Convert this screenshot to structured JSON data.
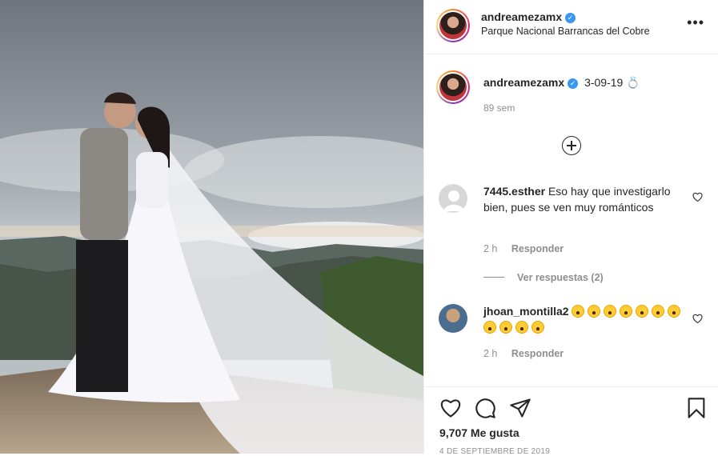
{
  "post": {
    "username": "andreamezamx",
    "location": "Parque Nacional Barrancas del Cobre",
    "caption_text": "3-09-19",
    "caption_emoji": "💍",
    "caption_time": "89 sem",
    "more_label": "•••",
    "likes": "9,707 Me gusta",
    "date": "4 DE SEPTIEMBRE DE 2019"
  },
  "comments": [
    {
      "username": "7445.esther",
      "text": "Eso hay que investigarlo bien, pues se ven muy románticos",
      "time": "2 h",
      "reply_label": "Responder",
      "view_replies": "Ver respuestas (2)"
    },
    {
      "username": "jhoan_montilla2",
      "emoji_count": 11,
      "time": "2 h",
      "reply_label": "Responder"
    }
  ],
  "icons": {
    "verified": "verified-badge-icon",
    "more": "more-options-icon",
    "add": "add-comment-circle-icon",
    "like": "heart-icon",
    "comment": "comment-bubble-icon",
    "share": "paper-plane-icon",
    "save": "bookmark-icon"
  },
  "colors": {
    "verified": "#3897f0",
    "muted": "#8e8e8e",
    "text": "#262626"
  }
}
